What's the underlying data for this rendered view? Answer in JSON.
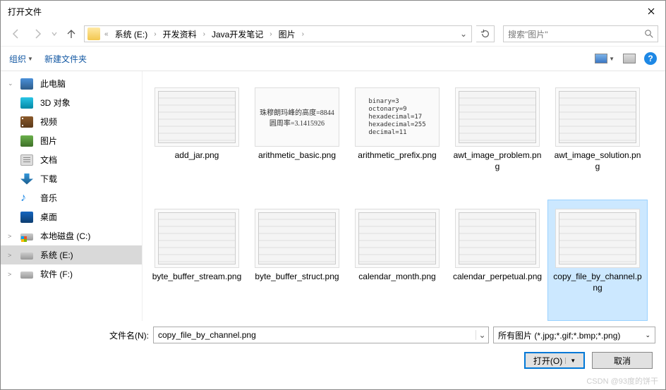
{
  "title": "打开文件",
  "breadcrumbs": [
    "系统 (E:)",
    "开发资料",
    "Java开发笔记",
    "图片"
  ],
  "search_placeholder": "搜索\"图片\"",
  "toolbar": {
    "organize": "组织",
    "newfolder": "新建文件夹"
  },
  "sidebar": [
    {
      "label": "此电脑",
      "icon": "ic-pc",
      "chev": "⌄"
    },
    {
      "label": "3D 对象",
      "icon": "ic-3d"
    },
    {
      "label": "视频",
      "icon": "ic-vid"
    },
    {
      "label": "图片",
      "icon": "ic-img"
    },
    {
      "label": "文档",
      "icon": "ic-doc"
    },
    {
      "label": "下载",
      "icon": "ic-dl"
    },
    {
      "label": "音乐",
      "icon": "ic-mus",
      "glyph": "♪"
    },
    {
      "label": "桌面",
      "icon": "ic-desk"
    },
    {
      "label": "本地磁盘 (C:)",
      "icon": "ic-drv win",
      "chev": ">"
    },
    {
      "label": "系统 (E:)",
      "icon": "ic-drv",
      "chev": ">",
      "selected": true
    },
    {
      "label": "软件 (F:)",
      "icon": "ic-drv",
      "chev": ">"
    }
  ],
  "files": [
    {
      "name": "add_jar.png",
      "preview_type": "fake"
    },
    {
      "name": "arithmetic_basic.png",
      "preview_type": "txt2",
      "preview": "珠穆朗玛峰的高度=8844\n圆周率=3.1415926"
    },
    {
      "name": "arithmetic_prefix.png",
      "preview_type": "txt",
      "preview": "binary=3\noctonary=9\nhexadecimal=17\nhexadecimal=255\ndecimal=11"
    },
    {
      "name": "awt_image_problem.png",
      "preview_type": "fake"
    },
    {
      "name": "awt_image_solution.png",
      "preview_type": "fake"
    },
    {
      "name": "byte_buffer_stream.png",
      "preview_type": "fake"
    },
    {
      "name": "byte_buffer_struct.png",
      "preview_type": "fake"
    },
    {
      "name": "calendar_month.png",
      "preview_type": "fake"
    },
    {
      "name": "calendar_perpetual.png",
      "preview_type": "fake"
    },
    {
      "name": "copy_file_by_channel.png",
      "preview_type": "fake",
      "selected": true
    }
  ],
  "filename_label": "文件名(N):",
  "filename_value": "copy_file_by_channel.png",
  "filter": "所有图片 (*.jpg;*.gif;*.bmp;*.png)",
  "open_btn": "打开(O)",
  "cancel_btn": "取消",
  "watermark": "CSDN @93度的饼干"
}
